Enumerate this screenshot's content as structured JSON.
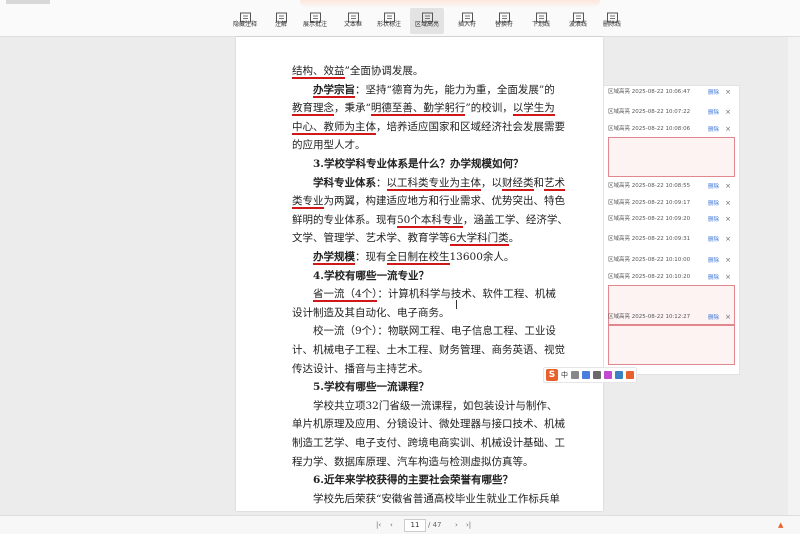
{
  "toolbar": {
    "tools": [
      {
        "label": "隐藏注释",
        "icon": "hide-annotation-icon"
      },
      {
        "label": "注解",
        "icon": "comment-icon"
      },
      {
        "label": "展示批注",
        "icon": "show-comments-icon"
      },
      {
        "label": "文本框",
        "icon": "textbox-icon"
      },
      {
        "label": "形状标注",
        "icon": "shape-markup-icon"
      },
      {
        "label": "区域高亮",
        "icon": "area-highlight-icon"
      },
      {
        "label": "插入符",
        "icon": "insert-caret-icon"
      },
      {
        "label": "替换符",
        "icon": "replace-caret-icon"
      },
      {
        "label": "下划线",
        "icon": "underline-icon"
      },
      {
        "label": "波浪线",
        "icon": "wavy-line-icon"
      },
      {
        "label": "删除线",
        "icon": "strikethrough-icon"
      }
    ]
  },
  "document": {
    "lines": [
      {
        "segs": [
          {
            "t": "结构、效益",
            "u": true
          },
          {
            "t": "”全面协调发展。"
          }
        ]
      },
      {
        "segs": [
          {
            "t": "　　"
          },
          {
            "t": "办学宗旨",
            "b": true,
            "u": true
          },
          {
            "t": "：坚持“德育为先，能力为重，全面发展”的"
          }
        ]
      },
      {
        "segs": [
          {
            "t": "教育理念",
            "u": true
          },
          {
            "t": "，秉承“"
          },
          {
            "t": "明德至善、勤学躬行",
            "u": true
          },
          {
            "t": "”的校训，"
          },
          {
            "t": "以学生为",
            "u": true
          }
        ]
      },
      {
        "segs": [
          {
            "t": "中心、教师为主体",
            "u": true
          },
          {
            "t": "，培养适应国家和区域经济社会发展需要"
          }
        ]
      },
      {
        "segs": [
          {
            "t": "的应用型人才。"
          }
        ]
      },
      {
        "segs": [
          {
            "t": "　　"
          },
          {
            "t": "3.学校学科专业体系是什么？办学规模如何？",
            "b": true
          }
        ]
      },
      {
        "segs": [
          {
            "t": "　　"
          },
          {
            "t": "学科专业体系",
            "b": true
          },
          {
            "t": "："
          },
          {
            "t": "以工科类专业为主体",
            "u": true
          },
          {
            "t": "，以"
          },
          {
            "t": "财经类",
            "u": true
          },
          {
            "t": "和"
          },
          {
            "t": "艺术",
            "u": true
          }
        ]
      },
      {
        "segs": [
          {
            "t": "类专业",
            "u": true
          },
          {
            "t": "为两翼，构建适应地方和行业需求、优势突出、特色"
          }
        ]
      },
      {
        "segs": [
          {
            "t": "鲜明的专业体系。现有"
          },
          {
            "t": "50个本科专业",
            "u": true
          },
          {
            "t": "，涵盖工学、经济学、"
          }
        ]
      },
      {
        "segs": [
          {
            "t": "文学、管理学、艺术学、教育学等"
          },
          {
            "t": "6大学科门类",
            "u": true
          },
          {
            "t": "。"
          }
        ]
      },
      {
        "segs": [
          {
            "t": "　　"
          },
          {
            "t": "办学规模",
            "b": true,
            "u": true
          },
          {
            "t": "：现有"
          },
          {
            "t": "全日制在校生",
            "u": true
          },
          {
            "t": "13600余人。"
          }
        ]
      },
      {
        "segs": [
          {
            "t": "　　"
          },
          {
            "t": "4.学校有哪些一流专业？",
            "b": true
          }
        ]
      },
      {
        "segs": [
          {
            "t": "　　"
          },
          {
            "t": "省一流（4个）",
            "u": true
          },
          {
            "t": "：计算机科学与技术、软件工程、机械"
          }
        ]
      },
      {
        "segs": [
          {
            "t": "设计制造及其自动化、电子商务。"
          }
        ]
      },
      {
        "segs": [
          {
            "t": "　　校一流（9个）：物联网工程、电子信息工程、工业设"
          }
        ]
      },
      {
        "segs": [
          {
            "t": "计、机械电子工程、土木工程、财务管理、商务英语、视觉"
          }
        ]
      },
      {
        "segs": [
          {
            "t": "传达设计、播音与主持艺术。"
          }
        ]
      },
      {
        "segs": [
          {
            "t": "　　"
          },
          {
            "t": "5.学校有哪些一流课程？",
            "b": true
          }
        ]
      },
      {
        "segs": [
          {
            "t": "　　学校共立项32门省级一流课程，如包装设计与制作、"
          }
        ]
      },
      {
        "segs": [
          {
            "t": "单片机原理及应用、分镜设计、微处理器与接口技术、机械"
          }
        ]
      },
      {
        "segs": [
          {
            "t": "制造工艺学、电子支付、跨境电商实训、机械设计基础、工"
          }
        ]
      },
      {
        "segs": [
          {
            "t": "程力学、数据库原理、汽车构造与检测虚拟仿真等。"
          }
        ]
      },
      {
        "segs": [
          {
            "t": "　　"
          },
          {
            "t": "6.近年来学校获得的主要社会荣誉有哪些？",
            "b": true
          }
        ]
      },
      {
        "segs": [
          {
            "t": "　　学校先后荣获“安徽省普通高校毕业生就业工作标兵单"
          }
        ]
      }
    ]
  },
  "annotations": {
    "delete_label": "删除",
    "items": [
      {
        "title": "区域高亮 2025-08-22 10:06:47",
        "box": false
      },
      {
        "title": "区域高亮 2025-08-22 10:07:22",
        "box": false
      },
      {
        "title": "区域高亮 2025-08-22 10:08:06",
        "box": true
      },
      {
        "title": "区域高亮 2025-08-22 10:08:55",
        "box": false
      },
      {
        "title": "区域高亮 2025-08-22 10:09:17",
        "box": false
      },
      {
        "title": "区域高亮 2025-08-22 10:09:20",
        "box": false
      },
      {
        "title": "区域高亮 2025-08-22 10:09:31",
        "box": false
      },
      {
        "title": "区域高亮 2025-08-22 10:10:00",
        "box": false
      },
      {
        "title": "区域高亮 2025-08-22 10:10:20",
        "box": true
      },
      {
        "title": "区域高亮 2025-08-22 10:12:27",
        "box": true
      }
    ]
  },
  "pagination": {
    "current": "11",
    "total": "/ 47"
  },
  "ime": {
    "logo": "S",
    "mode": "中"
  },
  "colors": {
    "underline": "#d01818",
    "note_border": "#e0888e",
    "accent": "#3a74d8"
  }
}
